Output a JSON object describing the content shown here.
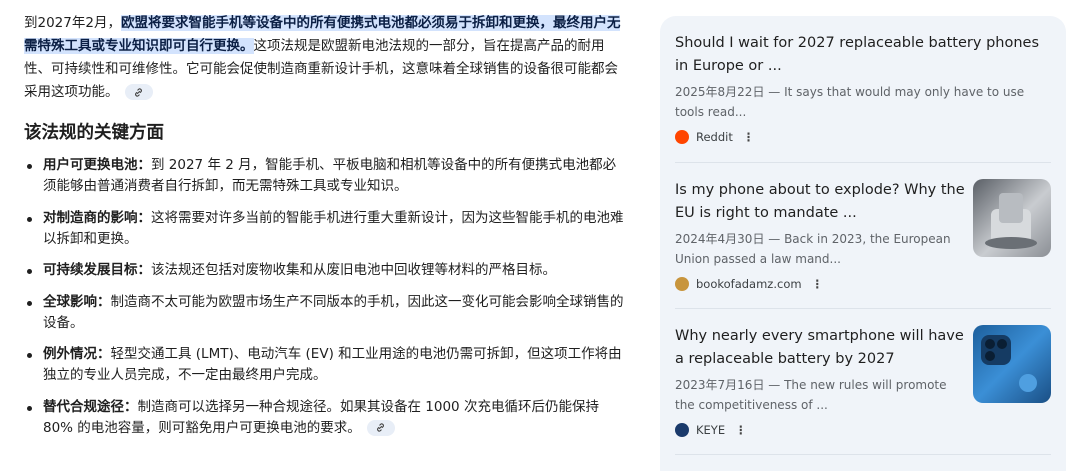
{
  "main": {
    "intro_prefix": "到2027年2月，",
    "intro_highlight": "欧盟将要求智能手机等设备中的所有便携式电池都必须易于拆卸和更换，最终用户无需特殊工具或专业知识即可自行更换。",
    "intro_rest": "这项法规是欧盟新电池法规的一部分，旨在提高产品的耐用性、可持续性和可维修性。它可能会促使制造商重新设计手机，这意味着全球销售的设备很可能都会采用这项功能。",
    "section_heading": "该法规的关键方面",
    "points": [
      {
        "term": "用户可更换电池：",
        "text": "到 2027 年 2 月，智能手机、平板电脑和相机等设备中的所有便携式电池都必须能够由普通消费者自行拆卸，而无需特殊工具或专业知识。"
      },
      {
        "term": "对制造商的影响：",
        "text": "这将需要对许多当前的智能手机进行重大重新设计，因为这些智能手机的电池难以拆卸和更换。"
      },
      {
        "term": "可持续发展目标：",
        "text": "该法规还包括对废物收集和从废旧电池中回收锂等材料的严格目标。"
      },
      {
        "term": "全球影响：",
        "text": "制造商不太可能为欧盟市场生产不同版本的手机，因此这一变化可能会影响全球销售的设备。"
      },
      {
        "term": "例外情况：",
        "text": "轻型交通工具 (LMT)、电动汽车 (EV) 和工业用途的电池仍需可拆卸，但这项工作将由独立的专业人员完成，不一定由最终用户完成。"
      },
      {
        "term": "替代合规途径：",
        "text": "制造商可以选择另一种合规途径。如果其设备在 1000 次充电循环后仍能保持 80% 的电池容量，则可豁免用户可更换电池的要求。"
      }
    ]
  },
  "sources": [
    {
      "title": "Should I wait for 2027 replaceable battery phones in Europe or ...",
      "snippet": "2025年8月22日 — It says that would may only have to use tools read...",
      "site": "Reddit",
      "favicon": "reddit-icon",
      "color": "#ff4500"
    },
    {
      "title": "Is my phone about to explode? Why the EU is right to mandate ...",
      "snippet": "2024年4月30日 — Back in 2023, the European Union passed a law mand...",
      "site": "bookofadamz.com",
      "favicon": "avatar-icon",
      "color": "#8a6d3b"
    },
    {
      "title": "Why nearly every smartphone will have a replaceable battery by 2027",
      "snippet": "2023年7月16日 — The new rules will promote the competitiveness of ...",
      "site": "KEYE",
      "favicon": "keye-icon",
      "color": "#1a3a6b"
    }
  ],
  "more_icon": "⋮"
}
